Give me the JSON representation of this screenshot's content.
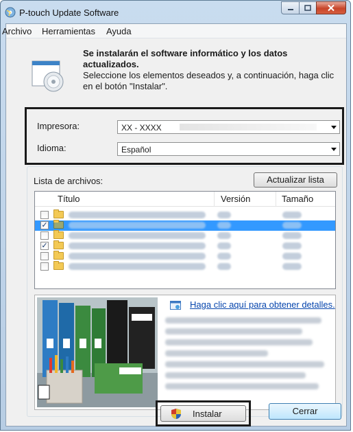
{
  "window": {
    "title": "P-touch Update Software",
    "min_icon": "minimize-icon",
    "max_icon": "maximize-icon",
    "close_icon": "close-icon"
  },
  "menu": [
    "Archivo",
    "Herramientas",
    "Ayuda"
  ],
  "header": {
    "title": "Se instalarán el software informático y los datos actualizados.",
    "description": "Seleccione los elementos deseados y, a continuación, haga clic en el botón \"Instalar\".",
    "icon": "software-disc-icon"
  },
  "printer": {
    "label": "Impresora:",
    "value": "XX - XXXX"
  },
  "language": {
    "label": "Idioma:",
    "value": "Español"
  },
  "files": {
    "label": "Lista de archivos:",
    "refresh_button": "Actualizar lista",
    "columns": [
      "Título",
      "Versión",
      "Tamaño"
    ],
    "rows": [
      {
        "checked": false,
        "selected": false,
        "folder": "yellow"
      },
      {
        "checked": true,
        "selected": true,
        "folder": "green"
      },
      {
        "checked": false,
        "selected": false,
        "folder": "yellow"
      },
      {
        "checked": true,
        "selected": false,
        "folder": "yellow"
      },
      {
        "checked": false,
        "selected": false,
        "folder": "yellow"
      },
      {
        "checked": false,
        "selected": false,
        "folder": "yellow"
      }
    ]
  },
  "info": {
    "link_text": "Haga clic aquí para obtener detalles.",
    "link_icon": "preview-icon"
  },
  "buttons": {
    "install": "Instalar",
    "close": "Cerrar",
    "install_icon": "shield-icon"
  },
  "colors": {
    "selection": "#3399ff",
    "link": "#0645ad"
  }
}
